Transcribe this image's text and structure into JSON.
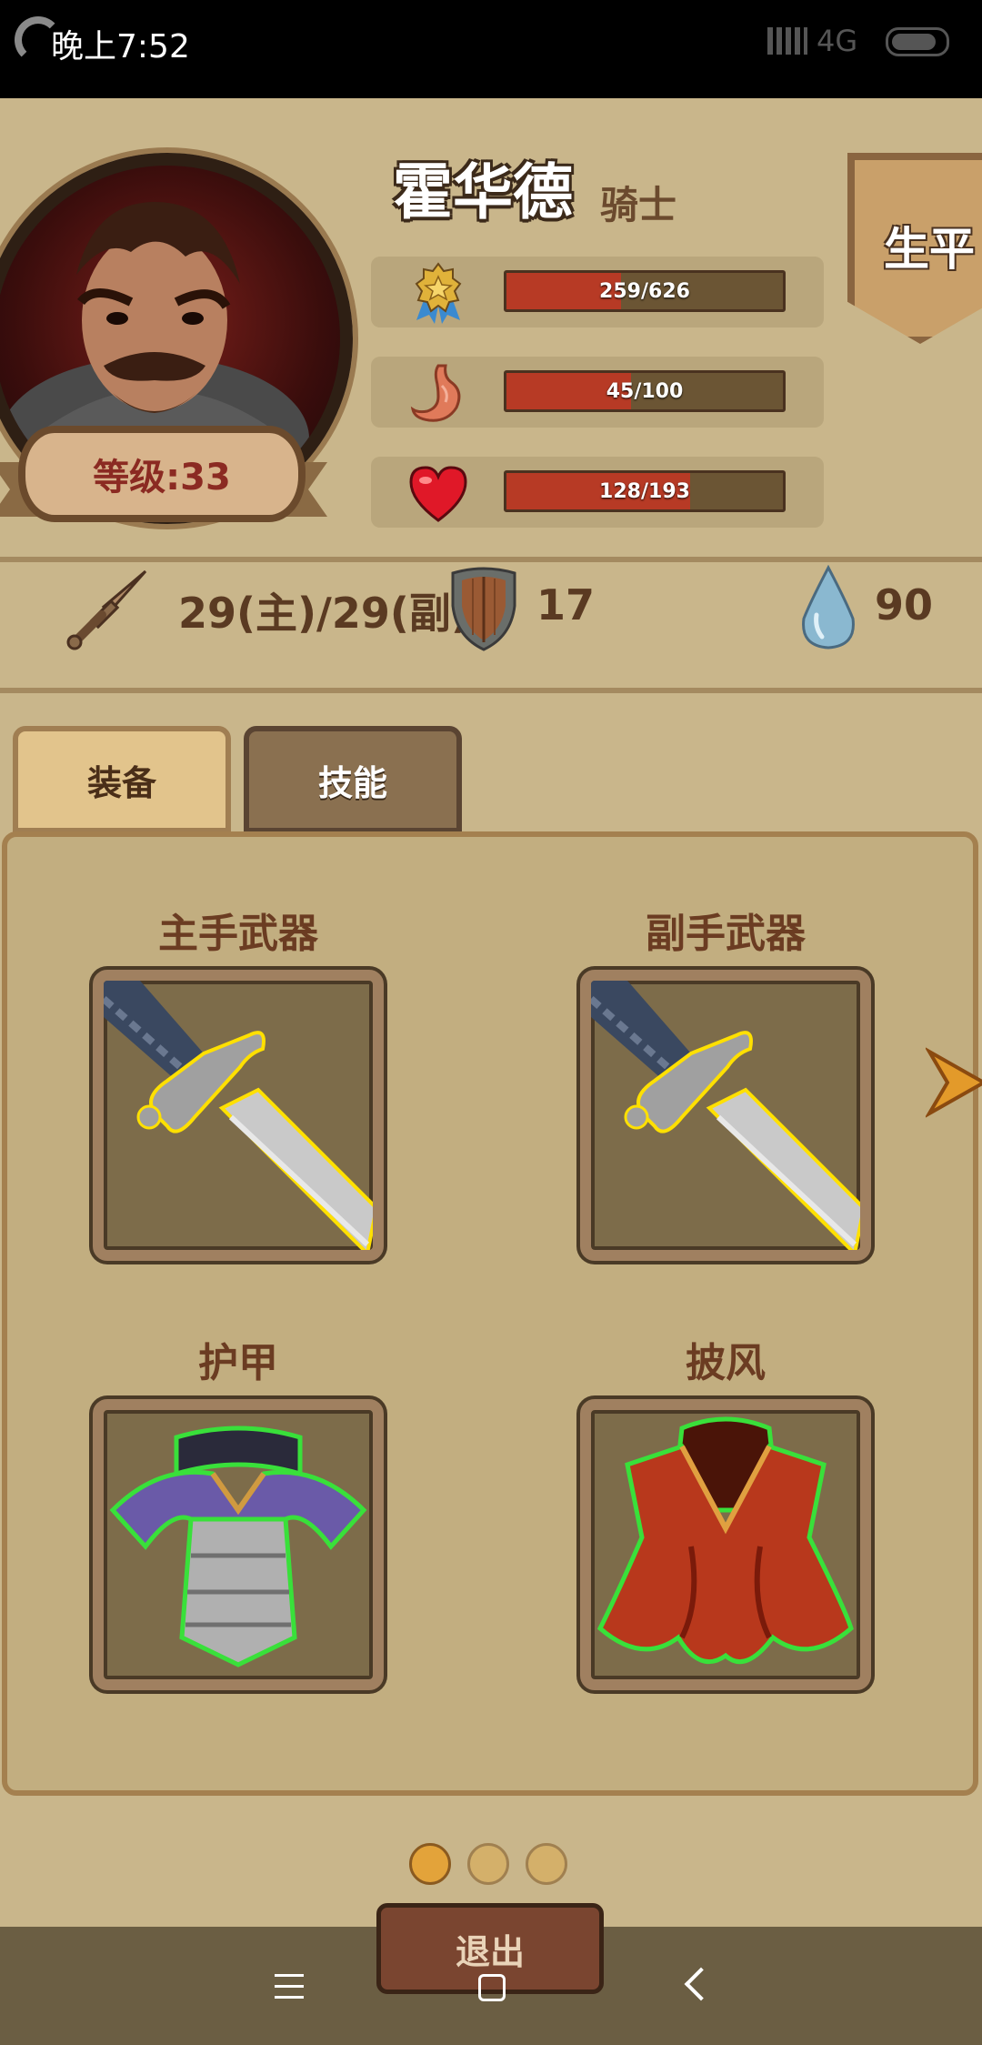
{
  "status_bar": {
    "time": "晚上7:52",
    "network": "4G"
  },
  "hero": {
    "name": "霍华德",
    "class": "骑士",
    "level_label": "等级:33",
    "career_button": "生平"
  },
  "stats": {
    "experience": {
      "text": "259/626",
      "current": 259,
      "max": 626,
      "icon": "medal-icon"
    },
    "hunger": {
      "text": "45/100",
      "current": 45,
      "max": 100,
      "icon": "stomach-icon"
    },
    "health": {
      "text": "128/193",
      "current": 128,
      "max": 193,
      "icon": "heart-icon"
    }
  },
  "combat": {
    "attack": "29(主)/29(副)",
    "defense": "17",
    "water": "90"
  },
  "tabs": {
    "equipment": "装备",
    "skills": "技能"
  },
  "slots": {
    "main_weapon": "主手武器",
    "off_weapon": "副手武器",
    "armor": "护甲",
    "cloak": "披风"
  },
  "pager": {
    "current": 1,
    "total": 3
  },
  "exit_button": "退出",
  "colors": {
    "background": "#c9b68b",
    "bar_fill": "#b73a25",
    "accent": "#e3a33a"
  }
}
